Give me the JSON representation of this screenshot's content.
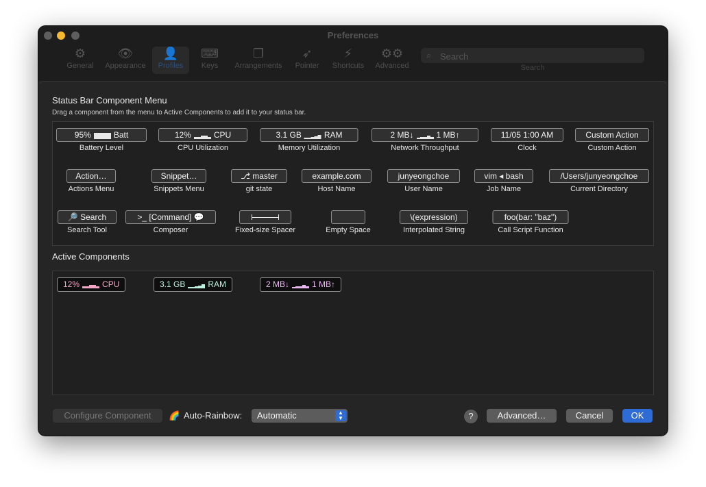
{
  "window": {
    "title": "Preferences",
    "traffic_colors": {
      "close": "#5e5e5e",
      "minimize": "#f5b72e",
      "zoom": "#5e5e5e"
    },
    "toolbar": [
      {
        "label": "General",
        "icon": "gear-icon"
      },
      {
        "label": "Appearance",
        "icon": "eye-icon"
      },
      {
        "label": "Profiles",
        "icon": "people-icon",
        "selected": true
      },
      {
        "label": "Keys",
        "icon": "keyboard-icon"
      },
      {
        "label": "Arrangements",
        "icon": "windows-icon"
      },
      {
        "label": "Pointer",
        "icon": "pointer-icon"
      },
      {
        "label": "Shortcuts",
        "icon": "bolt-icon"
      },
      {
        "label": "Advanced",
        "icon": "gears-icon"
      }
    ],
    "search": {
      "placeholder": "Search",
      "caption": "Search"
    }
  },
  "menu": {
    "title": "Status Bar Component Menu",
    "subtitle": "Drag a component from the menu to Active Components to add it to your status bar.",
    "components": [
      {
        "chip_pre": "95%",
        "chip_post": "Batt",
        "caption": "Battery Level",
        "spark": "battery"
      },
      {
        "chip_pre": "12%",
        "chip_post": "CPU",
        "caption": "CPU Utilization",
        "spark": "cpu"
      },
      {
        "chip_pre": "3.1 GB",
        "chip_post": "RAM",
        "caption": "Memory Utilization",
        "spark": "ram"
      },
      {
        "chip_pre": "2 MB↓",
        "chip_post": "1 MB↑",
        "caption": "Network Throughput",
        "spark": "net"
      },
      {
        "chip": "11/05 1:00 AM",
        "caption": "Clock"
      },
      {
        "chip": "Custom Action",
        "caption": "Custom Action"
      },
      {
        "chip": "Action…",
        "caption": "Actions Menu"
      },
      {
        "chip": "Snippet…",
        "caption": "Snippets Menu"
      },
      {
        "chip": "⎇ master",
        "caption": "git state"
      },
      {
        "chip": "example.com",
        "caption": "Host Name"
      },
      {
        "chip": "junyeongchoe",
        "caption": "User Name"
      },
      {
        "chip": "vim ◂ bash",
        "caption": "Job Name"
      },
      {
        "chip": "/Users/junyeongchoe",
        "caption": "Current Directory"
      },
      {
        "chip": "🔎 Search",
        "caption": "Search Tool"
      },
      {
        "chip": ">_ [Command] 💬",
        "caption": "Composer"
      },
      {
        "chip": "",
        "caption": "Fixed-size Spacer",
        "kind": "spacer"
      },
      {
        "chip": "",
        "caption": "Empty Space"
      },
      {
        "chip": "\\(expression)",
        "caption": "Interpolated String"
      },
      {
        "chip": "foo(bar: \"baz\")",
        "caption": "Call Script Function"
      }
    ]
  },
  "active": {
    "title": "Active Components",
    "items": [
      {
        "pre": "12%",
        "post": "CPU",
        "color": "#f0a6c4",
        "spark": "cpu"
      },
      {
        "pre": "3.1 GB",
        "post": "RAM",
        "color": "#bff0df",
        "spark": "ram"
      },
      {
        "pre": "2 MB↓",
        "post": "1 MB↑",
        "color": "#e9b6f0",
        "spark": "net"
      }
    ]
  },
  "footer": {
    "configure_label": "Configure Component",
    "rainbow_emoji": "🌈",
    "rainbow_label": "Auto-Rainbow:",
    "rainbow_value": "Automatic",
    "help_label": "?",
    "advanced_label": "Advanced…",
    "cancel_label": "Cancel",
    "ok_label": "OK"
  },
  "colors": {
    "accent": "#2f6bd4"
  }
}
